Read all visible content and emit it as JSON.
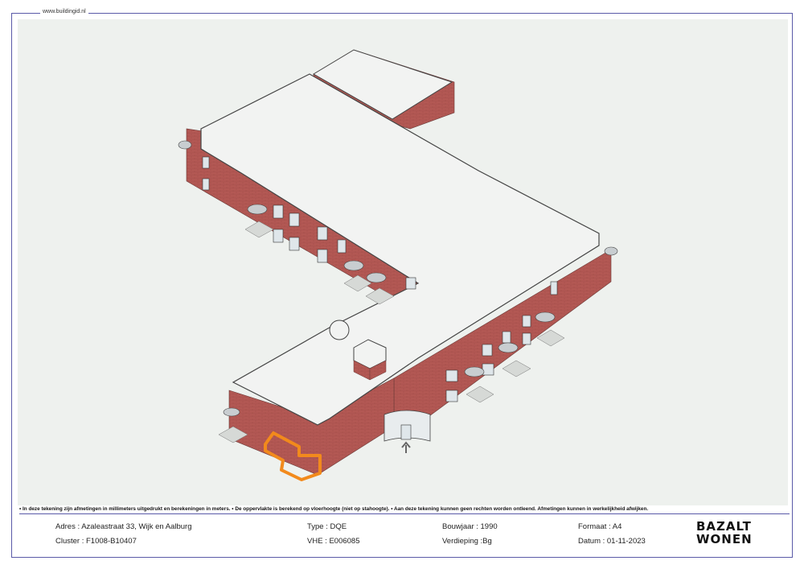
{
  "header": {
    "source_url": "www.buildingid.nl"
  },
  "drawing": {
    "highlight_color": "#f28a1c",
    "brick_color": "#b55a55",
    "roof_color": "#f0f2f0"
  },
  "disclaimer": "• In deze tekening zijn afmetingen in millimeters uitgedrukt en berekeningen in meters. • De oppervlakte is berekend op vloerhoogte (niet op stahoogte). • Aan deze tekening kunnen geen rechten worden ontleend. Afmetingen kunnen in werkelijkheid afwijken.",
  "info": {
    "adres": "Adres :  Azaleastraat 33, Wijk en Aalburg",
    "cluster": "Cluster :    F1008-B10407",
    "type": "Type : DQE",
    "vhe": "VHE :  E006085",
    "bouwjaar": "Bouwjaar : 1990",
    "verdieping": "Verdieping :Bg",
    "formaat": "Formaat : A4",
    "datum": "Datum : 01-11-2023"
  },
  "logo": {
    "line1": "BAZALT",
    "line2": "WONEN"
  }
}
